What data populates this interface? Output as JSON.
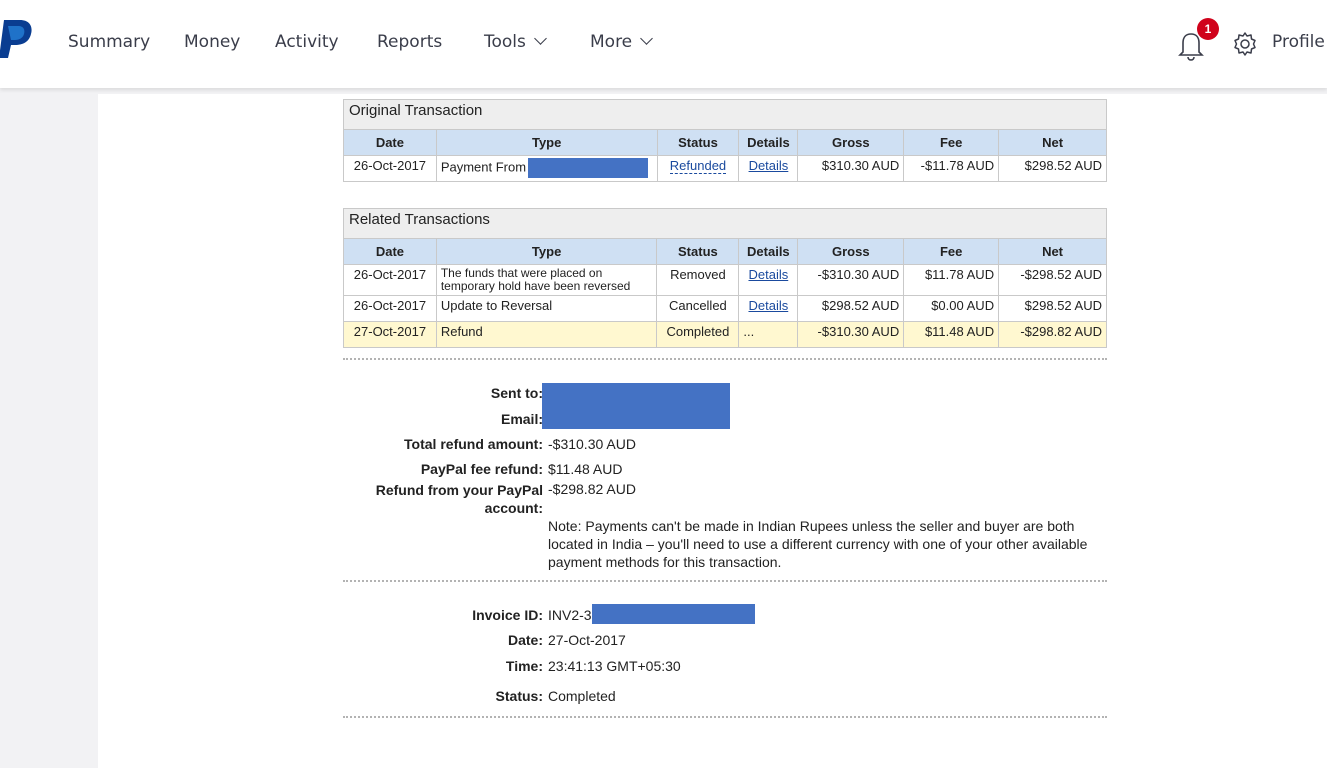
{
  "nav": {
    "items": [
      "Summary",
      "Money",
      "Activity",
      "Reports"
    ],
    "tools_label": "Tools",
    "more_label": "More",
    "notification_count": "1",
    "profile_label": "Profile"
  },
  "original": {
    "caption": "Original Transaction",
    "headers": [
      "Date",
      "Type",
      "Status",
      "Details",
      "Gross",
      "Fee",
      "Net"
    ],
    "row": {
      "date": "26-Oct-2017",
      "type": "Payment From",
      "status": "Refunded",
      "details": "Details",
      "gross": "$310.30 AUD",
      "fee": "-$11.78 AUD",
      "net": "$298.52 AUD"
    }
  },
  "related": {
    "caption": "Related Transactions",
    "headers": [
      "Date",
      "Type",
      "Status",
      "Details",
      "Gross",
      "Fee",
      "Net"
    ],
    "rows": [
      {
        "date": "26-Oct-2017",
        "type": "The funds that were placed on temporary hold have been reversed",
        "status": "Removed",
        "details": "Details",
        "gross": "-$310.30 AUD",
        "fee": "$11.78 AUD",
        "net": "-$298.52 AUD"
      },
      {
        "date": "26-Oct-2017",
        "type": "Update to Reversal",
        "status": "Cancelled",
        "details": "Details",
        "gross": "$298.52 AUD",
        "fee": "$0.00 AUD",
        "net": "$298.52 AUD"
      },
      {
        "date": "27-Oct-2017",
        "type": "Refund",
        "status": "Completed",
        "details": "...",
        "gross": "-$310.30 AUD",
        "fee": "$11.48 AUD",
        "net": "-$298.82 AUD"
      }
    ]
  },
  "refund": {
    "sent_to_label": "Sent to:",
    "email_label": "Email:",
    "total_label": "Total refund amount:",
    "total_value": "-$310.30 AUD",
    "fee_label": "PayPal fee refund:",
    "fee_value": "$11.48 AUD",
    "from_label": "Refund from your PayPal account:",
    "from_value": "-$298.82 AUD",
    "note": "Note: Payments can't be made in Indian Rupees unless the seller and buyer are both located in India – you'll need to use a different currency with one of your other available payment methods for this transaction."
  },
  "invoice": {
    "id_label": "Invoice ID:",
    "id_value": "INV2-3",
    "date_label": "Date:",
    "date_value": "27-Oct-2017",
    "time_label": "Time:",
    "time_value": "23:41:13 GMT+05:30",
    "status_label": "Status:",
    "status_value": "Completed"
  },
  "colors": {
    "redaction": "#4472c4",
    "header_bg": "#cfe0f3",
    "highlight_row": "#fff8d0",
    "badge": "#d0021b"
  }
}
